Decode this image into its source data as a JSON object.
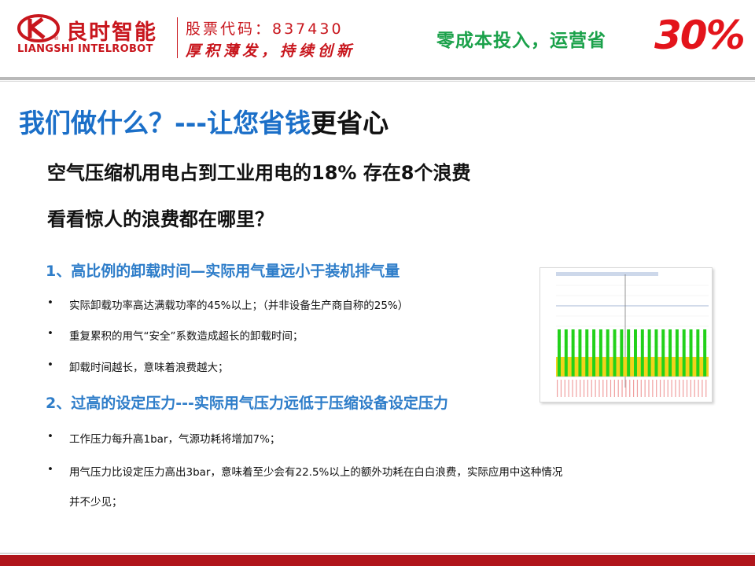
{
  "header": {
    "brand_cn": "良时智能",
    "brand_en": "LIANGSHI INTELROBOT",
    "stock": "股票代码：837430",
    "slogan": "厚积薄发，持续创新",
    "promo_text": "零成本投入，运营省",
    "promo_number": "30%"
  },
  "title": {
    "part1": "我们做什么？---让您",
    "highlight": "省钱",
    "part2": "更省心"
  },
  "subtitle1": "空气压缩机用电占到工业用电的18% 存在8个浪费",
  "subtitle2": "看看惊人的浪费都在哪里？",
  "section1": {
    "heading": "1、高比例的卸载时间—实际用气量远小于装机排气量",
    "bullets": [
      "实际卸载功率高达满载功率的45%以上；（并非设备生产商自称的25%）",
      "重复累积的用气“安全”系数造成超长的卸载时间；",
      "卸载时间越长，意味着浪费越大；"
    ]
  },
  "section2": {
    "heading": "2、过高的设定压力---实际用气压力远低于压缩设备设定压力",
    "bullets": [
      "工作压力每升高1bar，气源功耗将增加7%；",
      "用气压力比设定压力高出3bar，意味着至少会有22.5%以上的额外功耗在白白浪费，实际应用中这种情况"
    ],
    "continuation": "并不少见；"
  },
  "bullet_symbol": "•",
  "colors": {
    "brand_red": "#c8161d",
    "promo_green": "#1aa14a",
    "title_blue": "#1b6fc8",
    "section_blue": "#2e7dc9",
    "footer_red": "#b0151b",
    "chart_green": "#22d11a",
    "chart_yellow": "#f2d21b"
  }
}
